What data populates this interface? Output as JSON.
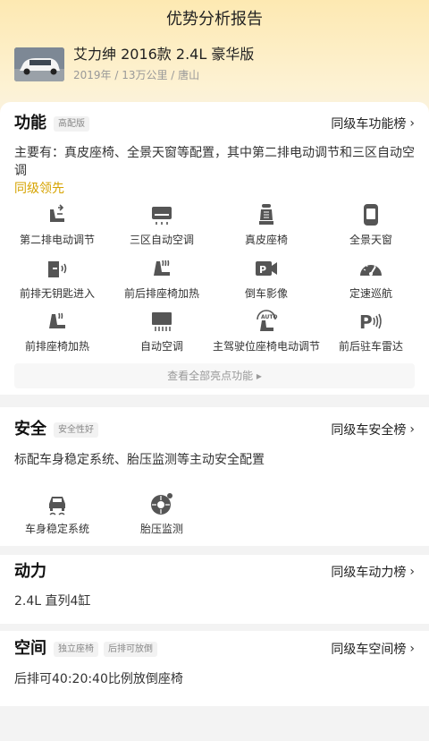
{
  "page": {
    "title": "优势分析报告"
  },
  "car": {
    "name": "艾力绅 2016款 2.4L 豪华版",
    "meta": "2019年 / 13万公里 / 唐山"
  },
  "function": {
    "title": "功能",
    "tag": "高配版",
    "rank_link": "同级车功能榜",
    "desc": "主要有：真皮座椅、全景天窗等配置，其中第二排电动调节和三区自动空调",
    "desc_highlight": "同级领先",
    "features": [
      {
        "label": "第二排电动调节",
        "icon": "seat-adjust-icon"
      },
      {
        "label": "三区自动空调",
        "icon": "air-conditioner-icon"
      },
      {
        "label": "真皮座椅",
        "icon": "leather-seat-icon"
      },
      {
        "label": "全景天窗",
        "icon": "sunroof-icon"
      },
      {
        "label": "前排无钥匙进入",
        "icon": "keyless-entry-icon"
      },
      {
        "label": "前后排座椅加热",
        "icon": "seat-heating-icon"
      },
      {
        "label": "倒车影像",
        "icon": "rear-camera-icon"
      },
      {
        "label": "定速巡航",
        "icon": "cruise-control-icon"
      },
      {
        "label": "前排座椅加热",
        "icon": "front-seat-heating-icon"
      },
      {
        "label": "自动空调",
        "icon": "auto-ac-icon"
      },
      {
        "label": "主驾驶位座椅电动调节",
        "icon": "driver-seat-power-icon"
      },
      {
        "label": "前后驻车雷达",
        "icon": "parking-radar-icon"
      }
    ],
    "view_all": "查看全部亮点功能 ▸"
  },
  "safety": {
    "title": "安全",
    "tag": "安全性好",
    "rank_link": "同级车安全榜",
    "desc": "标配车身稳定系统、胎压监测等主动安全配置",
    "features": [
      {
        "label": "车身稳定系统",
        "icon": "stability-control-icon"
      },
      {
        "label": "胎压监测",
        "icon": "tire-pressure-icon"
      }
    ]
  },
  "power": {
    "title": "动力",
    "rank_link": "同级车动力榜",
    "desc": "2.4L 直列4缸"
  },
  "space": {
    "title": "空间",
    "tags": [
      "独立座椅",
      "后排可放倒"
    ],
    "rank_link": "同级车空间榜",
    "desc": "后排可40:20:40比例放倒座椅"
  },
  "colors": {
    "accent": "#d6a300",
    "hero_top": "#fde9b2",
    "icon": "#555555"
  }
}
